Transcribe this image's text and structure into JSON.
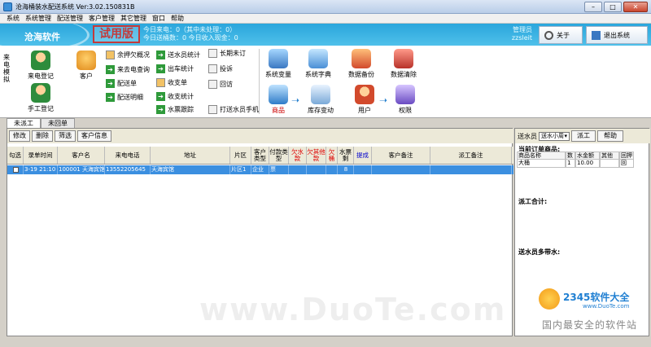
{
  "window": {
    "title": "沧海桶装水配送系统 Ver:3.02.150831B",
    "min": "–",
    "max": "□",
    "close": "✕"
  },
  "menu": [
    "系统",
    "系统管理",
    "配送管理",
    "客户管理",
    "其它管理",
    "窗口",
    "帮助"
  ],
  "banner": {
    "brand": "沧海软件",
    "trial": "试用版",
    "today_calls": "今日来电：0（其中未处理：0）",
    "today_delivery": "今日送桶数：0     今日收入现金：0",
    "user_role": "管理员",
    "user_name": "zzsleit",
    "about_label": "关于",
    "exit_label": "退出系统"
  },
  "toolbar": {
    "left_vertical": "来电模拟",
    "call_register": "来电登记",
    "manual_register": "手工登记",
    "customer": "客户",
    "col1": [
      "余押欠概况",
      "来去电查询",
      "配送单",
      "配送明细"
    ],
    "col2": [
      "送水员统计",
      "出车统计",
      "收支单",
      "收支统计",
      "水票跟踪"
    ],
    "col3": [
      "长期未订",
      "投诉",
      "回访",
      "打送水员手机"
    ],
    "big": [
      "系统变量",
      "系统字典",
      "数据备份",
      "数据清除",
      "商品",
      "库存变动",
      "用户",
      "权限"
    ]
  },
  "tabs": [
    "未派工",
    "未回单"
  ],
  "left_buttons": [
    "修改",
    "删除",
    "筛选",
    "客户信息"
  ],
  "grid": {
    "headers": [
      "勾选",
      "录单时间",
      "客户名",
      "来电电话",
      "地址",
      "片区",
      "客户类型",
      "付款类型",
      "欠水款",
      "欠其他款",
      "欠桶",
      "水票剩",
      "提成",
      "客户备注",
      "派工备注"
    ],
    "rows": [
      [
        "",
        "3-19 21:10",
        "100001 天海宾馆",
        "13552205645",
        "天海宾馆",
        "片区1",
        "企业",
        "票",
        "",
        "",
        "",
        "8",
        "",
        "",
        ""
      ]
    ]
  },
  "right": {
    "deliverer_label": "送水员",
    "deliverer_value": "送水小周",
    "dispatch_button": "派工",
    "help_button": "帮助",
    "current_order": "当前订单商品:",
    "order_headers": [
      "商品名称",
      "数",
      "水金额",
      "其他",
      "回押"
    ],
    "order_rows": [
      [
        "大桶",
        "1",
        "10.00",
        "",
        "回"
      ]
    ],
    "dispatch_total": "派工合计:",
    "deliverer_carry": "送水员多带水:"
  },
  "overlay": {
    "watermark": "www.DuoTe.com",
    "logo": "2345软件大全",
    "logo_url": "www.DuoTe.com",
    "slogan": "国内最安全的软件站"
  }
}
